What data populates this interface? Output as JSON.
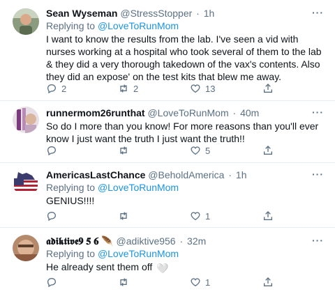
{
  "tweets": [
    {
      "name": "Sean Wyseman",
      "handle": "@StressStopper",
      "dot": "·",
      "time": "1h",
      "reply_prefix": "Replying to",
      "reply_to": "@LoveToRunMom",
      "text": "I want to know the results from the lab. I've seen a vid with nurses working at a hospital who took several of them to the lab & they did a very thorough takedown of the vax's contents. Also they did an expose' on the test kits that blew me away.",
      "replies": "2",
      "retweets": "2",
      "likes": "13",
      "more": "···"
    },
    {
      "name": "runnermom26runthat",
      "handle": "@LoveToRunMom",
      "dot": "·",
      "time": "40m",
      "text": "So do I more than you know!  For more reasons than you'll ever know I just want the truth I just want the truth!!",
      "replies": "",
      "retweets": "",
      "likes": "5",
      "more": "···"
    },
    {
      "name": "AmericasLastChance",
      "handle": "@BeholdAmerica",
      "dot": "·",
      "time": "1h",
      "reply_prefix": "Replying to",
      "reply_to": "@LoveToRunMom",
      "text": "GENIUS!!!!",
      "replies": "",
      "retweets": "",
      "likes": "1",
      "more": "···"
    },
    {
      "name": "𝖆𝖉𝖎𝖐𝖙𝖎𝖛𝖊𝟗 𝟓 𝟔",
      "name_emoji": "🪶",
      "handle": "@adiktive956",
      "dot": "·",
      "time": "32m",
      "reply_prefix": "Replying to",
      "reply_to": "@LoveToRunMom",
      "text": "He already sent them off",
      "text_emoji": "🤍",
      "replies": "",
      "retweets": "",
      "likes": "1",
      "more": "···"
    }
  ],
  "icons": {
    "reply": "reply-icon",
    "retweet": "retweet-icon",
    "like": "heart-icon",
    "share": "share-icon"
  },
  "colors": {
    "accent": "#1b95e0",
    "secondary_text": "#5b7083",
    "divider": "#e6ecf0"
  }
}
